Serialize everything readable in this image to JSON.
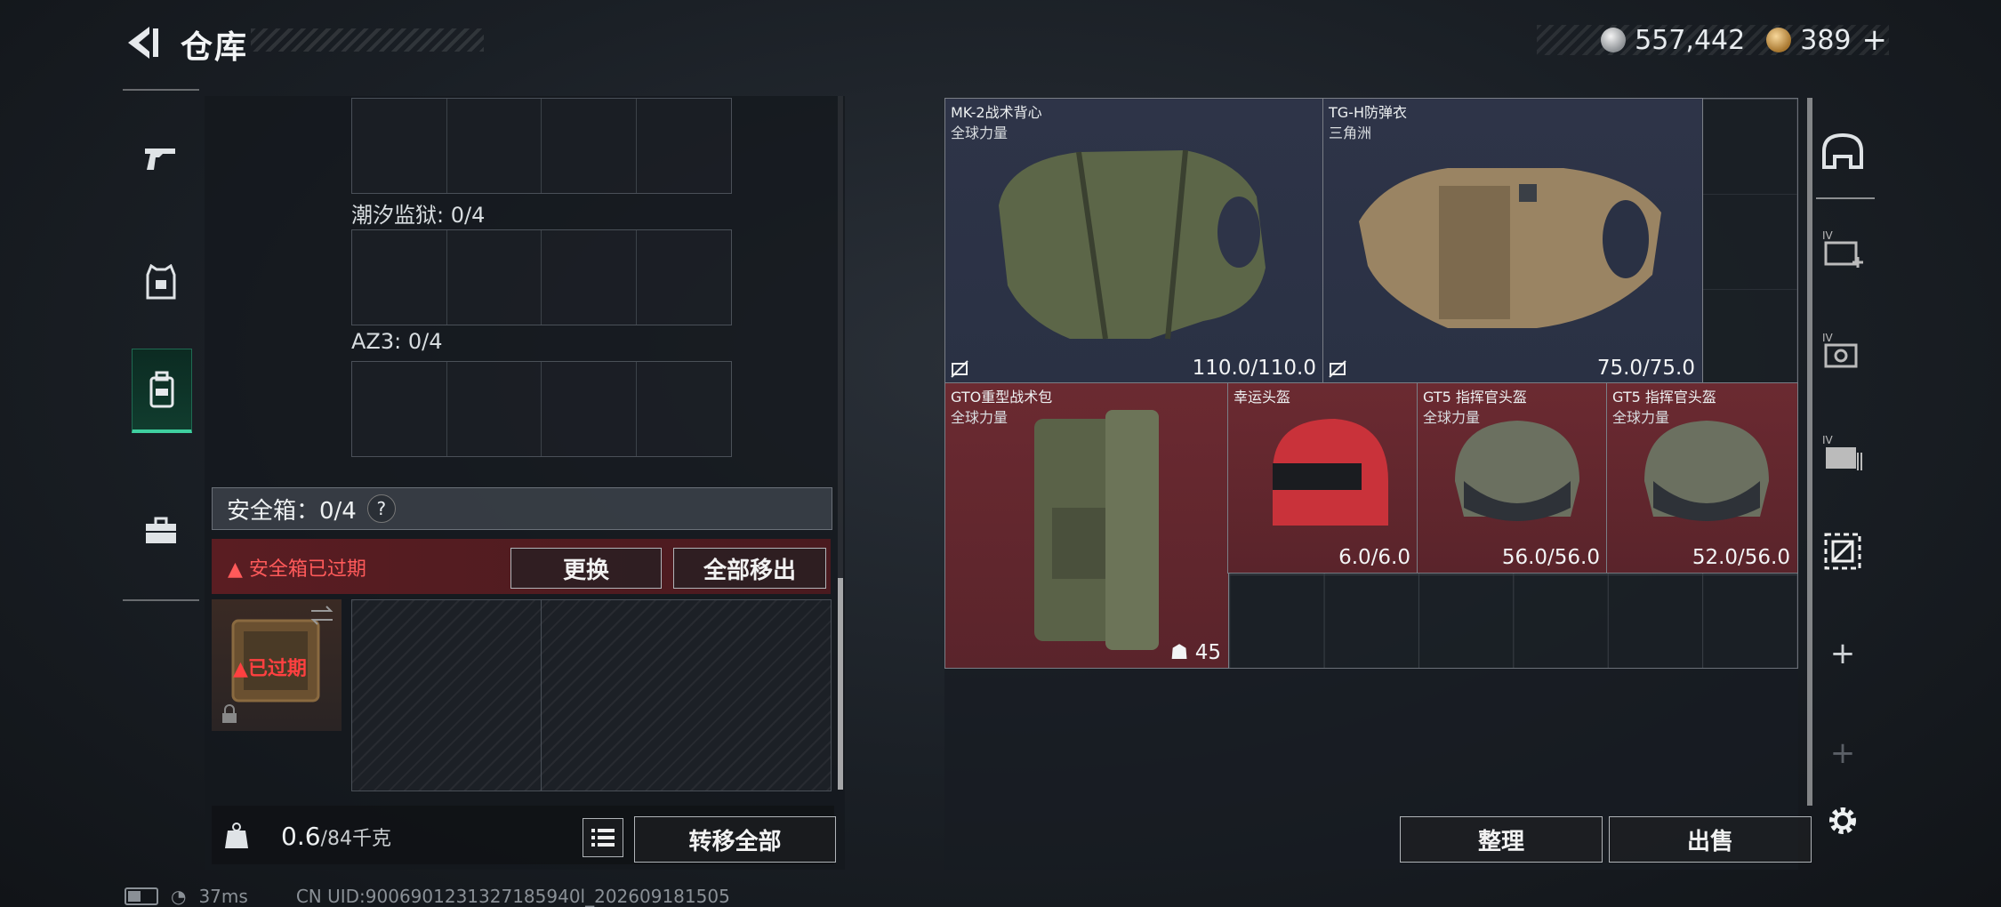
{
  "header": {
    "title": "仓库"
  },
  "currency": {
    "silver": "557,442",
    "gold": "389",
    "add": "+"
  },
  "left_nav": {
    "items": [
      {
        "id": "weapons",
        "icon": "pistol-icon"
      },
      {
        "id": "armor",
        "icon": "vest-icon"
      },
      {
        "id": "backpack",
        "icon": "backpack-icon",
        "active": true
      },
      {
        "id": "case",
        "icon": "briefcase-icon"
      }
    ]
  },
  "left_panel": {
    "slot_groups": [
      {
        "label": ""
      },
      {
        "label": "潮汐监狱: 0/4"
      },
      {
        "label": "AZ3: 0/4"
      }
    ],
    "safebox": {
      "label": "安全箱：0/4",
      "help": "?",
      "expired_text": "安全箱已过期",
      "replace": "更换",
      "remove_all": "全部移出",
      "thumb_status": "已过期"
    },
    "weight": {
      "current": "0.6",
      "max": "/84千克",
      "transfer_all": "转移全部"
    }
  },
  "inventory": {
    "items": [
      {
        "name": "MK-2战术背心",
        "sub": "全球力量",
        "durability": "110.0/110.0",
        "color": "blue"
      },
      {
        "name": "TG-H防弹衣",
        "sub": "三角洲",
        "durability": "75.0/75.0",
        "color": "blue"
      },
      {
        "name": "GTO重型战术包",
        "sub": "全球力量",
        "durability": "45",
        "color": "red"
      },
      {
        "name": "幸运头盔",
        "sub": "",
        "durability": "6.0/6.0",
        "color": "red"
      },
      {
        "name": "GT5 指挥官头盔",
        "sub": "全球力量",
        "durability": "56.0/56.0",
        "color": "red"
      },
      {
        "name": "GT5 指挥官头盔",
        "sub": "全球力量",
        "durability": "52.0/56.0",
        "color": "red"
      }
    ],
    "sort": "整理",
    "sell": "出售"
  },
  "right_nav": {
    "items": [
      "helmet-slot-icon",
      "add-vest-icon",
      "vest-slot-icon",
      "backpack-slot-icon",
      "grid-select-icon",
      "plus-icon",
      "plus-icon",
      "gear-icon"
    ]
  },
  "footer": {
    "ping": "37ms",
    "uid": "CN UID:9006901231327185940l_202609181505"
  },
  "colors": {
    "accent_green": "#3fd0a0",
    "expired_red": "#ff4040",
    "item_red": "#6b2a31",
    "item_blue": "#2e3448"
  }
}
